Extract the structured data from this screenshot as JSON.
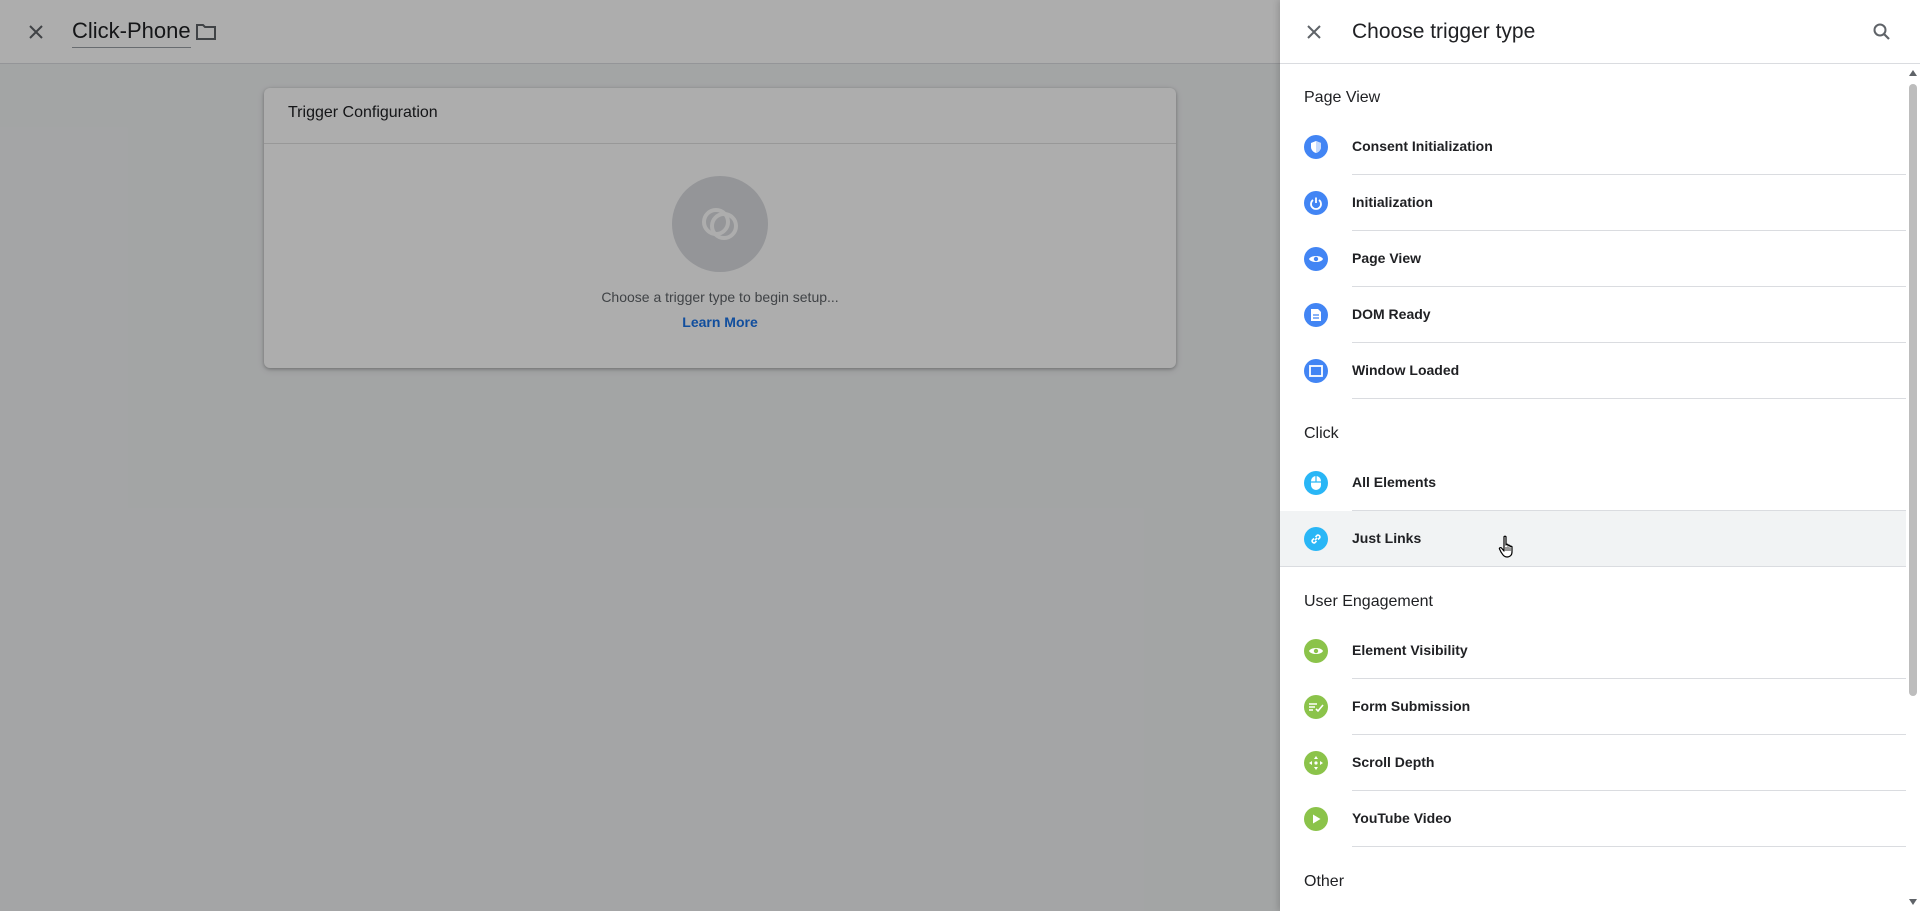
{
  "editor": {
    "title": "Click-Phone",
    "card": {
      "title": "Trigger Configuration",
      "hint": "Choose a trigger type to begin setup...",
      "link": "Learn More"
    }
  },
  "panel": {
    "title": "Choose trigger type",
    "sections": [
      {
        "name": "Page View",
        "items": [
          {
            "label": "Consent Initialization",
            "icon": "shield-icon",
            "color": "#4285f4"
          },
          {
            "label": "Initialization",
            "icon": "power-icon",
            "color": "#4285f4"
          },
          {
            "label": "Page View",
            "icon": "eye-icon",
            "color": "#4285f4"
          },
          {
            "label": "DOM Ready",
            "icon": "document-icon",
            "color": "#4285f4"
          },
          {
            "label": "Window Loaded",
            "icon": "window-icon",
            "color": "#4285f4"
          }
        ]
      },
      {
        "name": "Click",
        "items": [
          {
            "label": "All Elements",
            "icon": "mouse-icon",
            "color": "#29b6f6"
          },
          {
            "label": "Just Links",
            "icon": "link-icon",
            "color": "#29b6f6"
          }
        ]
      },
      {
        "name": "User Engagement",
        "items": [
          {
            "label": "Element Visibility",
            "icon": "eye-icon",
            "color": "#8bc34a"
          },
          {
            "label": "Form Submission",
            "icon": "form-check-icon",
            "color": "#8bc34a"
          },
          {
            "label": "Scroll Depth",
            "icon": "move-icon",
            "color": "#8bc34a"
          },
          {
            "label": "YouTube Video",
            "icon": "play-icon",
            "color": "#8bc34a"
          }
        ]
      },
      {
        "name": "Other",
        "items": []
      }
    ]
  }
}
